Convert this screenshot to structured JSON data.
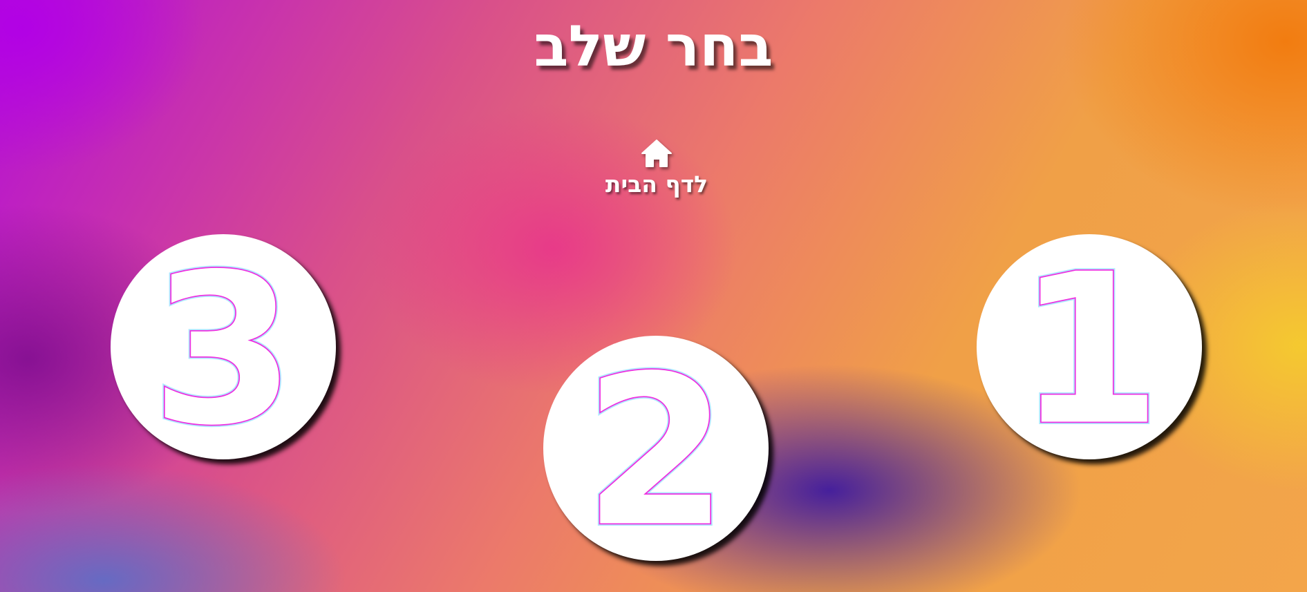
{
  "header": {
    "title": "בחר שלב"
  },
  "home": {
    "label": "לדף הבית",
    "icon": "home-icon"
  },
  "levels": [
    {
      "number": "1"
    },
    {
      "number": "2"
    },
    {
      "number": "3"
    }
  ],
  "colors": {
    "digit_outline": "#ee2fe0",
    "digit_glow": "#6fd6ff",
    "circle_fill": "#ffffff",
    "title_text": "#ffffff"
  }
}
